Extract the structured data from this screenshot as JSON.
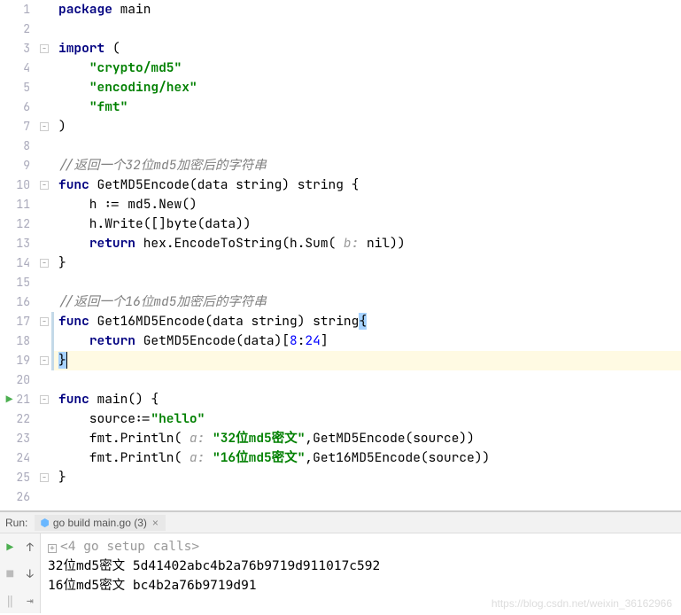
{
  "lines": [
    {
      "n": "1",
      "fold": "",
      "html": "<span class='kw'>package</span> main"
    },
    {
      "n": "2",
      "fold": "",
      "html": ""
    },
    {
      "n": "3",
      "fold": "⊟",
      "html": "<span class='kw'>import</span> ("
    },
    {
      "n": "4",
      "fold": "",
      "html": "    <span class='str'>\"crypto/md5\"</span>"
    },
    {
      "n": "5",
      "fold": "",
      "html": "    <span class='str'>\"encoding/hex\"</span>"
    },
    {
      "n": "6",
      "fold": "",
      "html": "    <span class='str'>\"fmt\"</span>"
    },
    {
      "n": "7",
      "fold": "⊟",
      "html": ")"
    },
    {
      "n": "8",
      "fold": "",
      "html": ""
    },
    {
      "n": "9",
      "fold": "",
      "html": "<span class='cmt'>//返回一个32位md5加密后的字符串</span>"
    },
    {
      "n": "10",
      "fold": "⊟",
      "html": "<span class='kw'>func</span> GetMD5Encode(data string) string {"
    },
    {
      "n": "11",
      "fold": "",
      "html": "    h := md5.New()"
    },
    {
      "n": "12",
      "fold": "",
      "html": "    h.Write([]byte(data))"
    },
    {
      "n": "13",
      "fold": "",
      "html": "    <span class='kw'>return</span> hex.EncodeToString(h.Sum( <span class='hint'>b:</span> nil))"
    },
    {
      "n": "14",
      "fold": "⊟",
      "html": "}"
    },
    {
      "n": "15",
      "fold": "",
      "html": ""
    },
    {
      "n": "16",
      "fold": "",
      "html": "<span class='cmt'>//返回一个16位md5加密后的字符串</span>"
    },
    {
      "n": "17",
      "fold": "⊟",
      "html": "<span class='kw'>func</span> Get16MD5Encode(data string) string<span class='sel'>{</span>",
      "bar": true
    },
    {
      "n": "18",
      "fold": "",
      "html": "    <span class='kw'>return</span> GetMD5Encode(data)[<span class='num'>8</span>:<span class='num'>24</span>]",
      "bar": true
    },
    {
      "n": "19",
      "fold": "⊟",
      "html": "<span class='sel'>}</span><span class='caret'></span>",
      "current": true,
      "bar": true
    },
    {
      "n": "20",
      "fold": "",
      "html": ""
    },
    {
      "n": "21",
      "fold": "⊟",
      "html": "<span class='kw'>func</span> main() {",
      "run": true
    },
    {
      "n": "22",
      "fold": "",
      "html": "    source:=<span class='str'>\"hello\"</span>"
    },
    {
      "n": "23",
      "fold": "",
      "html": "    fmt.Println( <span class='hint'>a:</span> <span class='str'>\"32位md5密文\"</span>,GetMD5Encode(source))"
    },
    {
      "n": "24",
      "fold": "",
      "html": "    fmt.Println( <span class='hint'>a:</span> <span class='str'>\"16位md5密文\"</span>,Get16MD5Encode(source))"
    },
    {
      "n": "25",
      "fold": "⊟",
      "html": "}"
    },
    {
      "n": "26",
      "fold": "",
      "html": ""
    }
  ],
  "run": {
    "label": "Run:",
    "tab": "go build main.go (3)",
    "output": [
      {
        "text": "<4 go setup calls>",
        "sys": true,
        "fold": true
      },
      {
        "text": "32位md5密文 5d41402abc4b2a76b9719d911017c592"
      },
      {
        "text": "16位md5密文 bc4b2a76b9719d91"
      }
    ]
  },
  "watermark": "https://blog.csdn.net/weixin_36162966"
}
